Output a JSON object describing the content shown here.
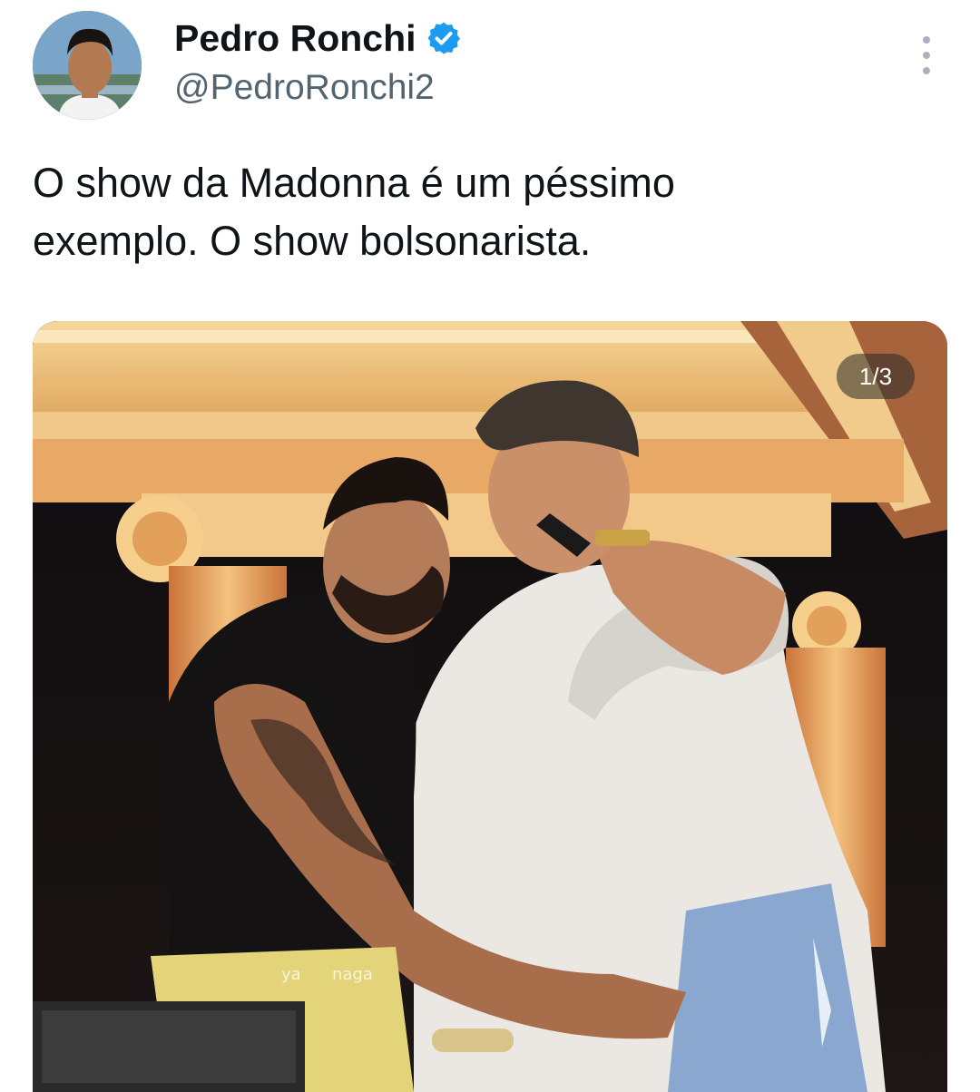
{
  "author": {
    "name": "Pedro Ronchi",
    "handle": "@PedroRonchi2",
    "verified": true,
    "verified_color": "#1d9bf0"
  },
  "tweet": {
    "text": "O show da Madonna é um péssimo\nexemplo. O show bolsonarista."
  },
  "media": {
    "counter": "1/3",
    "watermark": "ya      naga"
  },
  "icons": {
    "more": "more-vertical-icon",
    "verified": "verified-badge-icon"
  }
}
